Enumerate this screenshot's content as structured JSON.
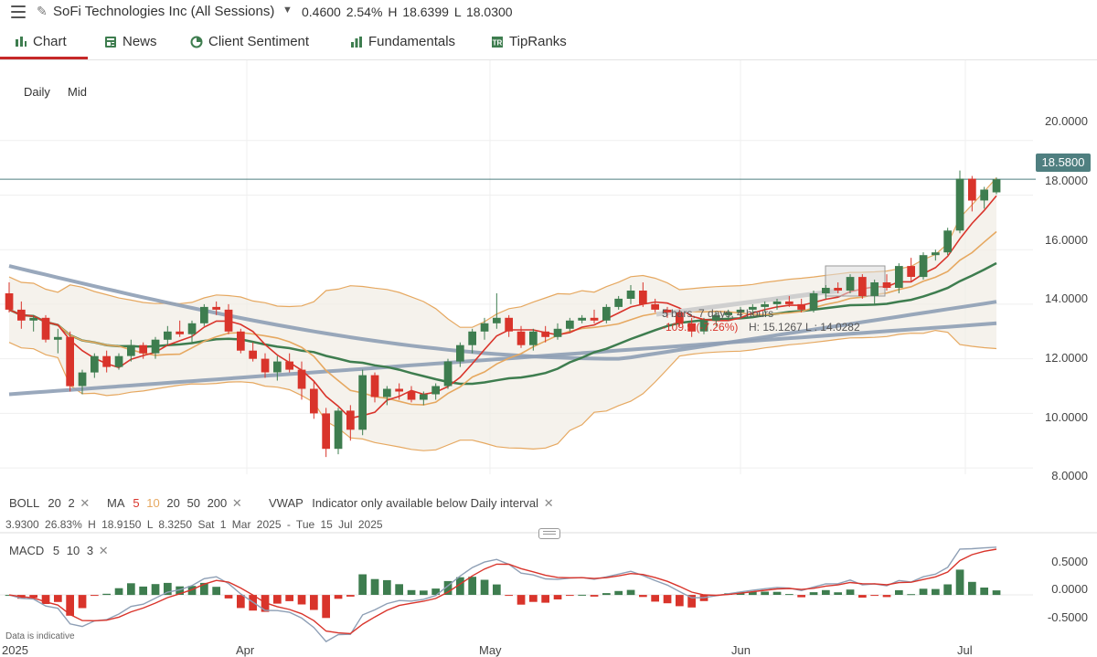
{
  "header": {
    "title": "SoFi Technologies Inc (All Sessions)",
    "change": "0.4600",
    "change_pct": "2.54%",
    "high": "H 18.6399",
    "low": "L 18.0300"
  },
  "tabs": [
    {
      "label": "Chart",
      "icon": "bar-chart-icon"
    },
    {
      "label": "News",
      "icon": "newspaper-icon"
    },
    {
      "label": "Client Sentiment",
      "icon": "pie-icon"
    },
    {
      "label": "Fundamentals",
      "icon": "bars-icon"
    },
    {
      "label": "TipRanks",
      "icon": "tr-icon"
    }
  ],
  "interval": {
    "period": "Daily",
    "price_type": "Mid"
  },
  "last_price_label": "18.5800",
  "indicators": {
    "boll": {
      "name": "BOLL",
      "p1": "20",
      "p2": "2"
    },
    "ma": {
      "name": "MA",
      "p1": "5",
      "p2": "10",
      "p3": "20",
      "p4": "50",
      "p5": "200"
    },
    "vwap": {
      "name": "VWAP",
      "note": "Indicator only available below Daily interval"
    },
    "macd": {
      "name": "MACD",
      "p1": "5",
      "p2": "10",
      "p3": "3"
    }
  },
  "range_stats": {
    "change": "3.9300",
    "pct": "26.83%",
    "high": "H 18.9150",
    "low": "L 8.3250",
    "dates": "Sat 1 Mar 2025 - Tue 15 Jul 2025"
  },
  "measure": {
    "bars": "5 bars, 7 days, 4 hours",
    "change": "-109.9 (-7.26%)",
    "hl": "H: 15.1267 L : 14.0282"
  },
  "footer_note": "Data is indicative",
  "colors": {
    "up": "#3e7d4f",
    "down": "#d9342b",
    "ma5": "#d9342b",
    "ma10": "#e6a860",
    "ma20": "#3e7d4f",
    "ma50": "#8e9fb5",
    "ma200": "#8e9fb5"
  },
  "chart_data": {
    "type": "candlestick",
    "x_ticks": [
      "2025",
      "Apr",
      "May",
      "Jun",
      "Jul"
    ],
    "y_ticks": [
      "20.0000",
      "18.0000",
      "16.0000",
      "14.0000",
      "12.0000",
      "10.0000",
      "8.0000"
    ],
    "ylim": [
      7.4,
      21.8
    ],
    "last_price": 18.58,
    "candles": [
      [
        14.4,
        14.8,
        13.7,
        13.8
      ],
      [
        13.8,
        14.1,
        13.1,
        13.4
      ],
      [
        13.4,
        13.6,
        13.0,
        13.5
      ],
      [
        13.5,
        13.6,
        12.6,
        12.7
      ],
      [
        12.7,
        13.1,
        12.2,
        12.8
      ],
      [
        12.8,
        13.0,
        10.8,
        11.0
      ],
      [
        11.0,
        11.6,
        10.7,
        11.5
      ],
      [
        11.5,
        12.2,
        11.3,
        12.1
      ],
      [
        12.1,
        12.3,
        11.5,
        11.7
      ],
      [
        11.7,
        12.2,
        11.6,
        12.1
      ],
      [
        12.1,
        12.7,
        11.9,
        12.5
      ],
      [
        12.5,
        12.6,
        12.0,
        12.2
      ],
      [
        12.2,
        12.8,
        12.0,
        12.7
      ],
      [
        12.7,
        13.2,
        12.5,
        13.0
      ],
      [
        13.0,
        13.4,
        12.8,
        12.9
      ],
      [
        12.9,
        13.4,
        12.6,
        13.3
      ],
      [
        13.3,
        14.0,
        13.2,
        13.9
      ],
      [
        13.9,
        14.1,
        13.6,
        13.8
      ],
      [
        13.8,
        14.0,
        12.9,
        13.0
      ],
      [
        13.0,
        13.1,
        12.2,
        12.3
      ],
      [
        12.3,
        12.6,
        11.9,
        12.0
      ],
      [
        12.0,
        12.2,
        11.3,
        11.5
      ],
      [
        11.5,
        12.1,
        11.2,
        11.9
      ],
      [
        11.9,
        12.2,
        11.5,
        11.6
      ],
      [
        11.6,
        11.9,
        10.5,
        10.9
      ],
      [
        10.9,
        11.2,
        9.8,
        10.0
      ],
      [
        10.0,
        10.2,
        8.4,
        8.7
      ],
      [
        8.7,
        10.2,
        8.5,
        10.1
      ],
      [
        10.1,
        10.3,
        9.0,
        9.4
      ],
      [
        9.4,
        11.6,
        9.2,
        11.4
      ],
      [
        11.4,
        11.5,
        10.4,
        10.6
      ],
      [
        10.6,
        11.0,
        10.3,
        10.9
      ],
      [
        10.9,
        11.1,
        10.5,
        10.8
      ],
      [
        10.8,
        11.0,
        10.4,
        10.5
      ],
      [
        10.5,
        10.8,
        10.3,
        10.7
      ],
      [
        10.7,
        11.1,
        10.5,
        11.0
      ],
      [
        11.0,
        12.0,
        10.9,
        11.9
      ],
      [
        11.9,
        12.6,
        11.7,
        12.5
      ],
      [
        12.5,
        13.1,
        12.2,
        13.0
      ],
      [
        13.0,
        13.5,
        12.7,
        13.3
      ],
      [
        13.3,
        14.4,
        13.1,
        13.5
      ],
      [
        13.5,
        13.6,
        12.8,
        13.0
      ],
      [
        13.0,
        13.2,
        12.4,
        12.5
      ],
      [
        12.5,
        13.1,
        12.3,
        13.0
      ],
      [
        13.0,
        13.2,
        12.6,
        12.8
      ],
      [
        12.8,
        13.3,
        12.7,
        13.1
      ],
      [
        13.1,
        13.5,
        13.0,
        13.4
      ],
      [
        13.4,
        13.6,
        13.3,
        13.5
      ],
      [
        13.5,
        13.8,
        13.3,
        13.4
      ],
      [
        13.4,
        14.0,
        13.3,
        13.9
      ],
      [
        13.9,
        14.3,
        13.8,
        14.2
      ],
      [
        14.2,
        14.7,
        14.0,
        14.5
      ],
      [
        14.5,
        14.8,
        13.9,
        14.0
      ],
      [
        14.0,
        14.2,
        13.7,
        13.8
      ],
      [
        13.8,
        13.9,
        13.5,
        13.7
      ],
      [
        13.7,
        13.8,
        13.2,
        13.3
      ],
      [
        13.3,
        13.5,
        12.8,
        13.0
      ],
      [
        13.0,
        13.5,
        12.9,
        13.4
      ],
      [
        13.4,
        13.7,
        13.2,
        13.6
      ],
      [
        13.6,
        13.8,
        13.4,
        13.7
      ],
      [
        13.7,
        13.9,
        13.5,
        13.8
      ],
      [
        13.8,
        14.0,
        13.6,
        13.9
      ],
      [
        13.9,
        14.1,
        13.7,
        14.0
      ],
      [
        14.0,
        14.2,
        13.8,
        14.1
      ],
      [
        14.1,
        14.3,
        13.9,
        14.0
      ],
      [
        14.0,
        14.2,
        13.7,
        13.8
      ],
      [
        13.8,
        14.5,
        13.7,
        14.4
      ],
      [
        14.4,
        14.7,
        14.2,
        14.6
      ],
      [
        14.6,
        14.8,
        14.4,
        14.5
      ],
      [
        14.5,
        15.1,
        14.4,
        15.0
      ],
      [
        15.0,
        15.1,
        14.2,
        14.3
      ],
      [
        14.3,
        14.9,
        14.0,
        14.8
      ],
      [
        14.8,
        15.1,
        14.5,
        14.6
      ],
      [
        14.6,
        15.5,
        14.4,
        15.4
      ],
      [
        15.4,
        15.7,
        14.8,
        15.0
      ],
      [
        15.0,
        15.9,
        14.9,
        15.8
      ],
      [
        15.8,
        16.0,
        15.6,
        15.9
      ],
      [
        15.9,
        16.8,
        15.8,
        16.7
      ],
      [
        16.7,
        18.9,
        16.6,
        18.6
      ],
      [
        18.6,
        18.7,
        17.4,
        17.8
      ],
      [
        17.8,
        18.3,
        17.5,
        18.2
      ],
      [
        18.1,
        18.64,
        18.03,
        18.58
      ]
    ]
  },
  "macd_data": {
    "y_ticks": [
      "0.5000",
      "0.0000",
      "-0.5000"
    ],
    "ylim": [
      -0.9,
      1.0
    ]
  }
}
